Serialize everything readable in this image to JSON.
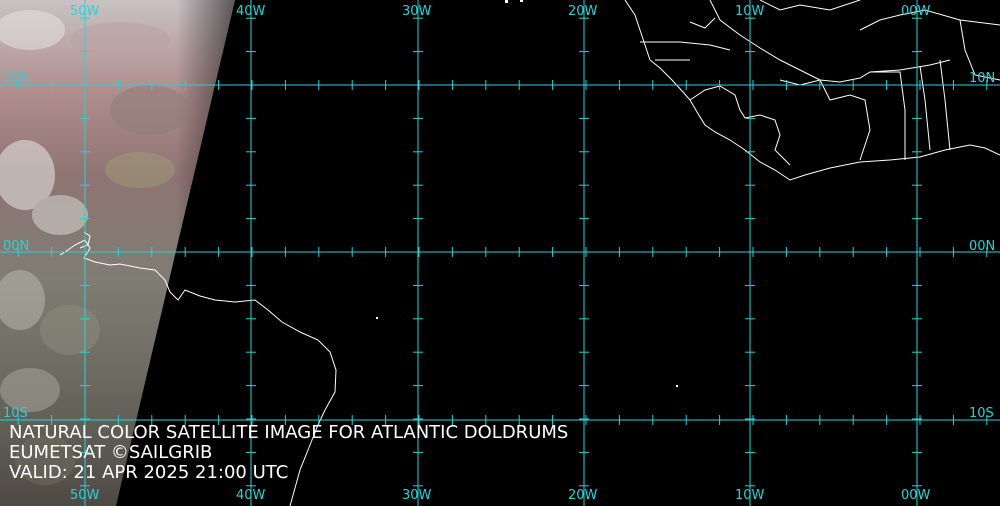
{
  "map": {
    "caption_line1": "NATURAL COLOR SATELLITE IMAGE FOR ATLANTIC DOLDRUMS",
    "caption_line2": "EUMETSAT ©SAILGRIB",
    "caption_line3": "VALID:  21 APR 2025 21:00 UTC",
    "lon_labels": [
      "50W",
      "40W",
      "30W",
      "20W",
      "10W",
      "00W"
    ],
    "lat_labels_left": [
      "10N",
      "00N",
      "10S"
    ],
    "lat_labels_right": [
      "10N",
      "00N",
      "10S"
    ],
    "colors": {
      "grid": "#27d3d8",
      "background": "#000000",
      "coastline": "#ffffff",
      "caption": "#ffffff"
    }
  }
}
